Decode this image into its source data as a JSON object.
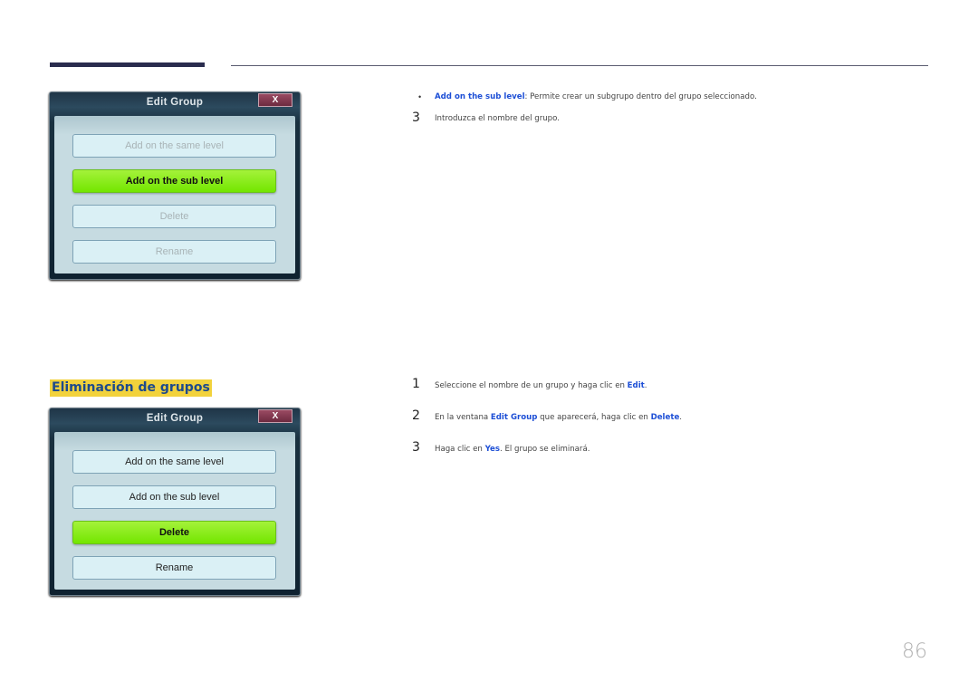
{
  "dialog_top": {
    "title": "Edit Group",
    "close_label": "X",
    "buttons": [
      {
        "label": "Add on the same level",
        "state": "disabled"
      },
      {
        "label": "Add on the sub level",
        "state": "active"
      },
      {
        "label": "Delete",
        "state": "disabled"
      },
      {
        "label": "Rename",
        "state": "disabled"
      }
    ]
  },
  "dialog_bottom": {
    "title": "Edit Group",
    "close_label": "X",
    "buttons": [
      {
        "label": "Add on the same level",
        "state": "normal"
      },
      {
        "label": "Add on the sub level",
        "state": "normal"
      },
      {
        "label": "Delete",
        "state": "active"
      },
      {
        "label": "Rename",
        "state": "normal"
      }
    ]
  },
  "top_text": {
    "bullet": "•",
    "bullet_term": "Add on the sub level",
    "bullet_rest": ": Permite crear un subgrupo dentro del grupo seleccionado.",
    "step3_num": "3",
    "step3_text": "Introduzca el nombre del grupo."
  },
  "section": {
    "title": "Eliminación de grupos",
    "steps": [
      {
        "num": "1",
        "pre": "Seleccione el nombre de un grupo y haga clic en ",
        "term": "Edit",
        "post": "."
      },
      {
        "num": "2",
        "pre": "En la ventana ",
        "term": "Edit Group",
        "mid": " que aparecerá, haga clic en ",
        "term2": "Delete",
        "post": "."
      },
      {
        "num": "3",
        "pre": "Haga clic en ",
        "term": "Yes",
        "post": ". El grupo se eliminará."
      }
    ]
  },
  "page_number": "86",
  "colors": {
    "highlight_text": "#1d4fd6",
    "section_bg": "#f2d23c",
    "active_button": "#73e600"
  }
}
